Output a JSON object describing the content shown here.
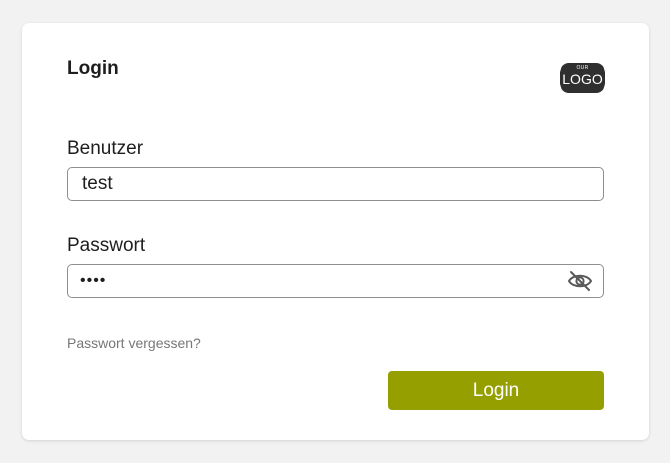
{
  "card": {
    "title": "Login",
    "logo": {
      "small": "OUR",
      "big": "LOGO"
    }
  },
  "form": {
    "username_label": "Benutzer",
    "username_value": "test",
    "password_label": "Passwort",
    "password_masked": "••••",
    "forgot_link": "Passwort vergessen?",
    "submit_label": "Login"
  },
  "colors": {
    "accent": "#95a000",
    "logo_bg": "#2f2f2f",
    "link": "#777777"
  },
  "icons": {
    "password_toggle": "eye-slash-icon"
  }
}
